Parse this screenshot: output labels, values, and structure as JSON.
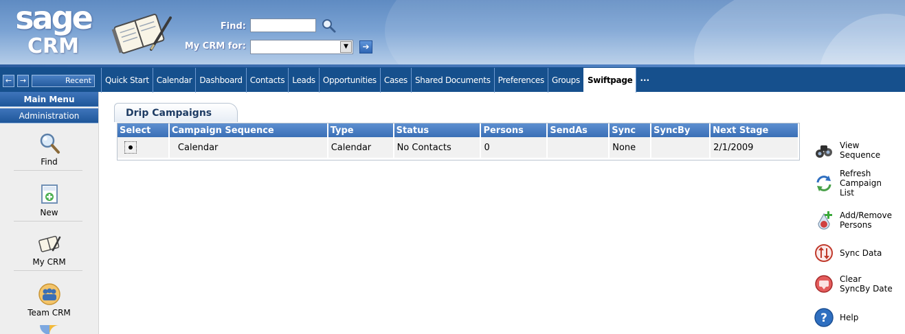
{
  "header": {
    "logo_top": "sage",
    "logo_bottom": "CRM",
    "find_label": "Find:",
    "find_value": "",
    "mycrm_label": "My CRM for:",
    "mycrm_value": ""
  },
  "nav": {
    "back_label": "←",
    "forward_label": "→",
    "recent_label": "Recent"
  },
  "tabs": [
    {
      "label": "Quick Start"
    },
    {
      "label": "Calendar"
    },
    {
      "label": "Dashboard"
    },
    {
      "label": "Contacts"
    },
    {
      "label": "Leads"
    },
    {
      "label": "Opportunities"
    },
    {
      "label": "Cases"
    },
    {
      "label": "Shared Documents"
    },
    {
      "label": "Preferences"
    },
    {
      "label": "Groups"
    },
    {
      "label": "Swiftpage",
      "active": true
    },
    {
      "label": "···"
    }
  ],
  "sidebar": {
    "main_menu": "Main Menu",
    "administration": "Administration",
    "items": [
      {
        "label": "Find",
        "icon": "magnifier-icon"
      },
      {
        "label": "New",
        "icon": "new-document-icon"
      },
      {
        "label": "My CRM",
        "icon": "notebook-icon"
      },
      {
        "label": "Team CRM",
        "icon": "team-icon"
      }
    ]
  },
  "panel": {
    "title": "Drip Campaigns",
    "columns": [
      "Select",
      "Campaign Sequence",
      "Type",
      "Status",
      "Persons",
      "SendAs",
      "Sync",
      "SyncBy",
      "Next Stage"
    ],
    "rows": [
      {
        "selected": true,
        "campaign_sequence": "Calendar",
        "type": "Calendar",
        "status": "No Contacts",
        "persons": "0",
        "send_as": "",
        "sync": "None",
        "sync_by": "",
        "next_stage": "2/1/2009"
      }
    ]
  },
  "actions": [
    {
      "label_lines": [
        "View",
        "Sequence"
      ],
      "icon": "binoculars-icon"
    },
    {
      "label_lines": [
        "Refresh",
        "Campaign",
        "List"
      ],
      "icon": "refresh-icon"
    },
    {
      "label_lines": [
        "Add/Remove",
        "Persons"
      ],
      "icon": "add-persons-icon"
    },
    {
      "label_lines": [
        "Sync Data"
      ],
      "icon": "sync-icon"
    },
    {
      "label_lines": [
        "Clear",
        "SyncBy Date"
      ],
      "icon": "clear-icon"
    },
    {
      "label_lines": [
        "Help"
      ],
      "icon": "help-icon"
    }
  ],
  "colors": {
    "tab_bar": "#16508d",
    "grid_header": "#4a80c4",
    "header_top": "#5f8bc2"
  }
}
